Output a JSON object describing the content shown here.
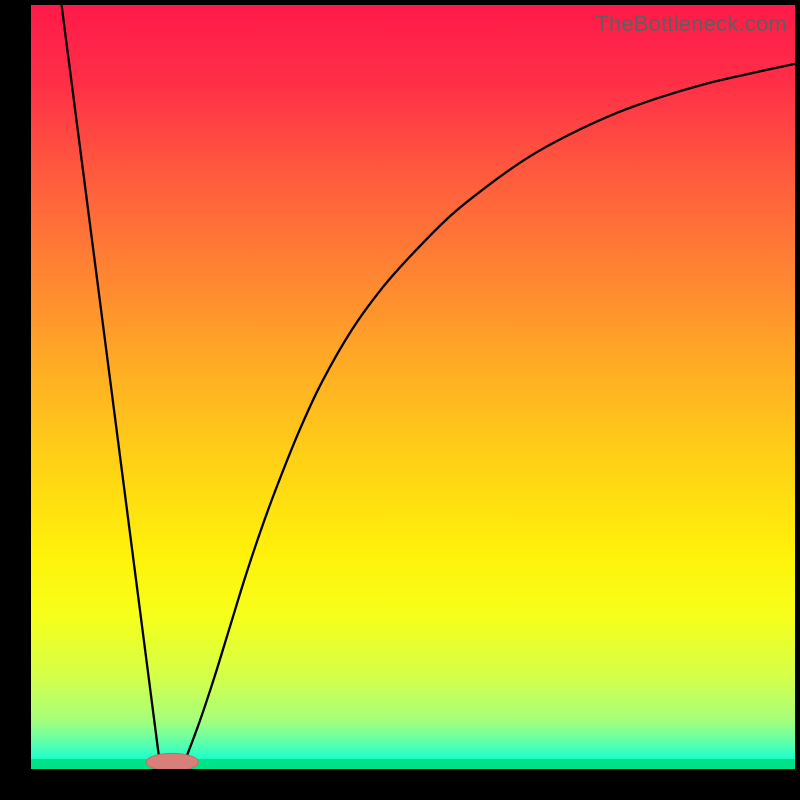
{
  "watermark": "TheBottleneck.com",
  "colors": {
    "black": "#000000",
    "curve": "#000000",
    "marker_fill": "#d97f7a",
    "marker_stroke": "#c96b66"
  },
  "gradient_stops": [
    {
      "offset": 0.0,
      "color": "#ff1a49"
    },
    {
      "offset": 0.1,
      "color": "#ff2e47"
    },
    {
      "offset": 0.22,
      "color": "#ff5a3e"
    },
    {
      "offset": 0.35,
      "color": "#ff8432"
    },
    {
      "offset": 0.48,
      "color": "#ffae24"
    },
    {
      "offset": 0.6,
      "color": "#ffd215"
    },
    {
      "offset": 0.72,
      "color": "#fff20a"
    },
    {
      "offset": 0.8,
      "color": "#f6ff1a"
    },
    {
      "offset": 0.88,
      "color": "#d4ff4a"
    },
    {
      "offset": 0.935,
      "color": "#a7ff7a"
    },
    {
      "offset": 0.965,
      "color": "#5fffac"
    },
    {
      "offset": 0.985,
      "color": "#1fffc8"
    },
    {
      "offset": 1.0,
      "color": "#00d88c"
    }
  ],
  "chart_data": {
    "type": "line",
    "title": "",
    "xlabel": "",
    "ylabel": "",
    "xlim": [
      0,
      100
    ],
    "ylim": [
      0,
      100
    ],
    "series": [
      {
        "name": "left-descent",
        "x": [
          4.0,
          16.8
        ],
        "y": [
          100.0,
          1.2
        ]
      },
      {
        "name": "right-ascent",
        "x": [
          20.2,
          22,
          24,
          26,
          28,
          30,
          32,
          35,
          38,
          42,
          46,
          50,
          55,
          60,
          65,
          70,
          76,
          82,
          88,
          94,
          100
        ],
        "y": [
          1.2,
          6.0,
          12.0,
          18.5,
          25.0,
          31.0,
          36.5,
          44.0,
          50.5,
          57.5,
          63.0,
          67.5,
          72.5,
          76.5,
          80.0,
          82.8,
          85.6,
          87.8,
          89.6,
          91.0,
          92.3
        ]
      }
    ],
    "marker": {
      "name": "bottleneck-marker",
      "cx": 18.5,
      "cy": 0.9,
      "rx_pct": 3.4,
      "ry_pct": 1.15
    }
  }
}
